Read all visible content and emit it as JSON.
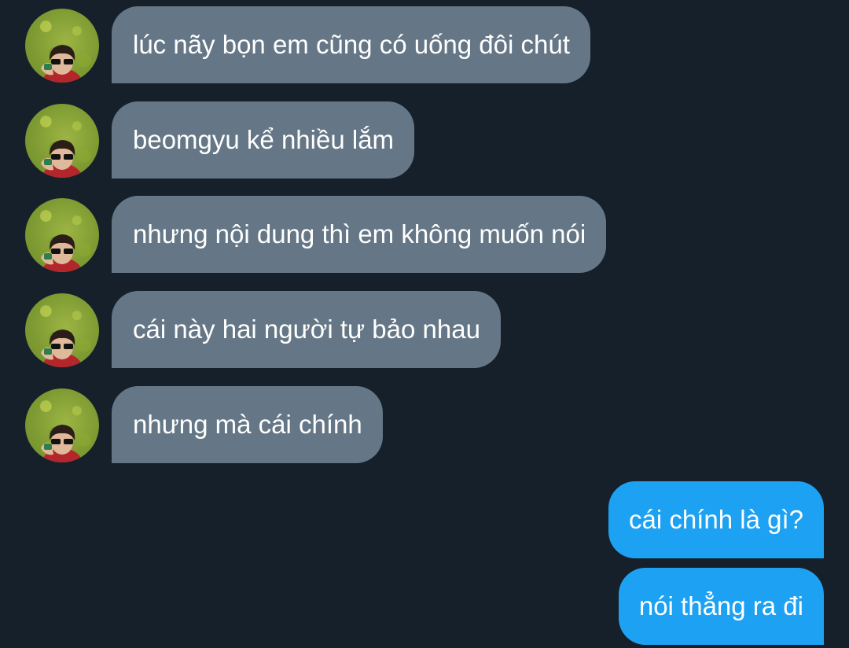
{
  "messages_in": [
    {
      "text": "lúc nãy bọn em cũng có uống đôi chút"
    },
    {
      "text": "beomgyu kể nhiều lắm"
    },
    {
      "text": "nhưng nội dung thì em không muốn nói"
    },
    {
      "text": "cái này hai người tự bảo nhau"
    },
    {
      "text": "nhưng mà cái chính"
    }
  ],
  "messages_out": [
    {
      "text": "cái chính là gì?"
    },
    {
      "text": "nói thẳng ra đi"
    }
  ],
  "colors": {
    "background": "#16202a",
    "incoming_bubble": "#657786",
    "outgoing_bubble": "#1da1f2",
    "text": "#ffffff"
  },
  "icons": {
    "avatar": "avatar-icon"
  }
}
